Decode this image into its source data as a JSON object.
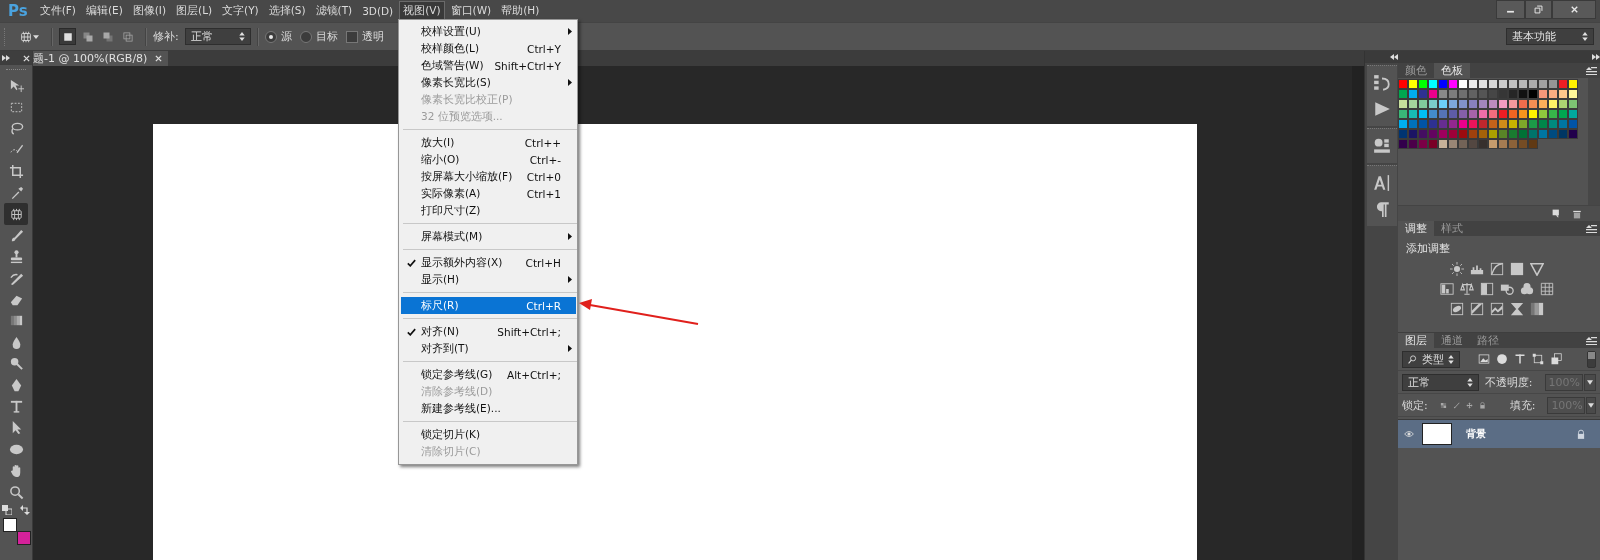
{
  "app_logo": "Ps",
  "menu_bar": [
    {
      "label": "文件(F)",
      "selected": false
    },
    {
      "label": "编辑(E)",
      "selected": false
    },
    {
      "label": "图像(I)",
      "selected": false
    },
    {
      "label": "图层(L)",
      "selected": false
    },
    {
      "label": "文字(Y)",
      "selected": false
    },
    {
      "label": "选择(S)",
      "selected": false
    },
    {
      "label": "滤镜(T)",
      "selected": false
    },
    {
      "label": "3D(D)",
      "selected": false
    },
    {
      "label": "视图(V)",
      "selected": true
    },
    {
      "label": "窗口(W)",
      "selected": false
    },
    {
      "label": "帮助(H)",
      "selected": false
    }
  ],
  "options_bar": {
    "mode_buttons": [
      {
        "selected": true
      },
      {
        "selected": false
      },
      {
        "selected": false
      },
      {
        "selected": false
      }
    ],
    "patch_label": "修补:",
    "patch_mode": "正常",
    "radios": [
      {
        "label": "源",
        "selected": true
      },
      {
        "label": "目标",
        "selected": false
      }
    ],
    "transparent": {
      "label": "透明",
      "checked": false
    },
    "workspace": "基本功能"
  },
  "document_tab": {
    "title": "题-1 @ 100%(RGB/8)"
  },
  "tools": [
    {
      "kind": "move",
      "selected": false
    },
    {
      "kind": "marquee",
      "selected": false
    },
    {
      "kind": "lasso",
      "selected": false
    },
    {
      "kind": "quick",
      "selected": false
    },
    {
      "kind": "crop",
      "selected": false
    },
    {
      "kind": "eyedropper",
      "selected": false
    },
    {
      "kind": "patch",
      "selected": true
    },
    {
      "kind": "brush",
      "selected": false
    },
    {
      "kind": "stamp",
      "selected": false
    },
    {
      "kind": "history",
      "selected": false
    },
    {
      "kind": "eraser",
      "selected": false
    },
    {
      "kind": "gradient",
      "selected": false
    },
    {
      "kind": "drop",
      "selected": false
    },
    {
      "kind": "dodge",
      "selected": false
    },
    {
      "kind": "pen",
      "selected": false
    },
    {
      "kind": "type",
      "selected": false
    },
    {
      "kind": "select",
      "selected": false
    },
    {
      "kind": "ellipse",
      "selected": false
    },
    {
      "kind": "hand",
      "selected": false
    },
    {
      "kind": "zoom",
      "selected": false
    }
  ],
  "colors": [
    {
      "kind": "foreground",
      "color": "#ffffff"
    },
    {
      "kind": "background",
      "color": "#d4219a"
    }
  ],
  "view_menu": {
    "groups": [
      {
        "items": [
          {
            "label": "校样设置(U)",
            "submenu": true,
            "disabled": false,
            "checked": false,
            "selected": false
          },
          {
            "label": "校样颜色(L)",
            "shortcut": "Ctrl+Y",
            "submenu": false,
            "disabled": false,
            "checked": false,
            "selected": false
          },
          {
            "label": "色域警告(W)",
            "shortcut": "Shift+Ctrl+Y",
            "submenu": false,
            "disabled": false,
            "checked": false,
            "selected": false
          },
          {
            "label": "像素长宽比(S)",
            "submenu": true,
            "disabled": false,
            "checked": false,
            "selected": false
          },
          {
            "label": "像素长宽比校正(P)",
            "submenu": false,
            "disabled": true,
            "checked": false,
            "selected": false
          },
          {
            "label": "32 位预览选项...",
            "submenu": false,
            "disabled": true,
            "checked": false,
            "selected": false
          }
        ]
      },
      {
        "items": [
          {
            "label": "放大(I)",
            "shortcut": "Ctrl++",
            "submenu": false,
            "disabled": false,
            "checked": false,
            "selected": false
          },
          {
            "label": "缩小(O)",
            "shortcut": "Ctrl+-",
            "submenu": false,
            "disabled": false,
            "checked": false,
            "selected": false
          },
          {
            "label": "按屏幕大小缩放(F)",
            "shortcut": "Ctrl+0",
            "submenu": false,
            "disabled": false,
            "checked": false,
            "selected": false
          },
          {
            "label": "实际像素(A)",
            "shortcut": "Ctrl+1",
            "submenu": false,
            "disabled": false,
            "checked": false,
            "selected": false
          },
          {
            "label": "打印尺寸(Z)",
            "submenu": false,
            "disabled": false,
            "checked": false,
            "selected": false
          }
        ]
      },
      {
        "items": [
          {
            "label": "屏幕模式(M)",
            "submenu": true,
            "disabled": false,
            "checked": false,
            "selected": false
          }
        ]
      },
      {
        "items": [
          {
            "label": "显示额外内容(X)",
            "shortcut": "Ctrl+H",
            "submenu": false,
            "disabled": false,
            "checked": true,
            "selected": false
          },
          {
            "label": "显示(H)",
            "submenu": true,
            "disabled": false,
            "checked": false,
            "selected": false
          }
        ]
      },
      {
        "items": [
          {
            "label": "标尺(R)",
            "shortcut": "Ctrl+R",
            "submenu": false,
            "disabled": false,
            "checked": false,
            "selected": true
          }
        ]
      },
      {
        "items": [
          {
            "label": "对齐(N)",
            "shortcut": "Shift+Ctrl+;",
            "submenu": false,
            "disabled": false,
            "checked": true,
            "selected": false
          },
          {
            "label": "对齐到(T)",
            "submenu": true,
            "disabled": false,
            "checked": false,
            "selected": false
          }
        ]
      },
      {
        "items": [
          {
            "label": "锁定参考线(G)",
            "shortcut": "Alt+Ctrl+;",
            "submenu": false,
            "disabled": false,
            "checked": false,
            "selected": false
          },
          {
            "label": "清除参考线(D)",
            "submenu": false,
            "disabled": true,
            "checked": false,
            "selected": false
          },
          {
            "label": "新建参考线(E)...",
            "submenu": false,
            "disabled": false,
            "checked": false,
            "selected": false
          }
        ]
      },
      {
        "items": [
          {
            "label": "锁定切片(K)",
            "submenu": false,
            "disabled": false,
            "checked": false,
            "selected": false
          },
          {
            "label": "清除切片(C)",
            "submenu": false,
            "disabled": true,
            "checked": false,
            "selected": false
          }
        ]
      }
    ]
  },
  "swatches_panel": {
    "tabs": [
      {
        "label": "颜色",
        "selected": false
      },
      {
        "label": "色板",
        "selected": true
      }
    ],
    "rows": [
      {
        "swatches": [
          {
            "color": "#ff0000"
          },
          {
            "color": "#ffff00"
          },
          {
            "color": "#00ff00"
          },
          {
            "color": "#00ffff"
          },
          {
            "color": "#0000ff"
          },
          {
            "color": "#ff00ff"
          },
          {
            "color": "#ffffff"
          },
          {
            "color": "#ebebeb"
          },
          {
            "color": "#e1e1e1"
          },
          {
            "color": "#d7d7d7"
          },
          {
            "color": "#cccccc"
          },
          {
            "color": "#c2c2c2"
          },
          {
            "color": "#b7b7b7"
          },
          {
            "color": "#acacac"
          },
          {
            "color": "#a0a0a0"
          },
          {
            "color": "#959595"
          },
          {
            "color": "#ee1d24"
          },
          {
            "color": "#fff100"
          }
        ]
      },
      {
        "swatches": [
          {
            "color": "#00a650"
          },
          {
            "color": "#00aeef"
          },
          {
            "color": "#2e3192"
          },
          {
            "color": "#ec008c"
          },
          {
            "color": "#898989"
          },
          {
            "color": "#7d7d7d"
          },
          {
            "color": "#707070"
          },
          {
            "color": "#626262"
          },
          {
            "color": "#555555"
          },
          {
            "color": "#464646"
          },
          {
            "color": "#363636"
          },
          {
            "color": "#262626"
          },
          {
            "color": "#111111"
          },
          {
            "color": "#000000"
          },
          {
            "color": "#f7977a"
          },
          {
            "color": "#fbad82"
          },
          {
            "color": "#fdc68c"
          },
          {
            "color": "#fff799"
          }
        ]
      },
      {
        "swatches": [
          {
            "color": "#c6df9c"
          },
          {
            "color": "#a4d49d"
          },
          {
            "color": "#81ca9d"
          },
          {
            "color": "#7bcdc9"
          },
          {
            "color": "#6ccff6"
          },
          {
            "color": "#7da7d9"
          },
          {
            "color": "#8293ca"
          },
          {
            "color": "#8881be"
          },
          {
            "color": "#a286bd"
          },
          {
            "color": "#bc8cbf"
          },
          {
            "color": "#f49bc1"
          },
          {
            "color": "#f5999d"
          },
          {
            "color": "#f16c4d"
          },
          {
            "color": "#f68e54"
          },
          {
            "color": "#fbaf5a"
          },
          {
            "color": "#fff467"
          },
          {
            "color": "#acd372"
          },
          {
            "color": "#7dc473"
          }
        ]
      },
      {
        "swatches": [
          {
            "color": "#39b778"
          },
          {
            "color": "#17bcb4"
          },
          {
            "color": "#00bff3"
          },
          {
            "color": "#438ccb"
          },
          {
            "color": "#5573b7"
          },
          {
            "color": "#5e5ca7"
          },
          {
            "color": "#855fa8"
          },
          {
            "color": "#a763a9"
          },
          {
            "color": "#ef6ea8"
          },
          {
            "color": "#f16d7e"
          },
          {
            "color": "#ee1d24"
          },
          {
            "color": "#f16522"
          },
          {
            "color": "#f7941d"
          },
          {
            "color": "#fff100"
          },
          {
            "color": "#8fc63d"
          },
          {
            "color": "#37b44a"
          },
          {
            "color": "#00a650"
          },
          {
            "color": "#00a99e"
          }
        ]
      },
      {
        "swatches": [
          {
            "color": "#00aeef"
          },
          {
            "color": "#0072bc"
          },
          {
            "color": "#0054a6"
          },
          {
            "color": "#2e3192"
          },
          {
            "color": "#662d91"
          },
          {
            "color": "#92278f"
          },
          {
            "color": "#ec008c"
          },
          {
            "color": "#ed145b"
          },
          {
            "color": "#c1272d"
          },
          {
            "color": "#c4621a"
          },
          {
            "color": "#d08b1a"
          },
          {
            "color": "#c8b400"
          },
          {
            "color": "#7ea82a"
          },
          {
            "color": "#1c9a48"
          },
          {
            "color": "#00874a"
          },
          {
            "color": "#008a7e"
          },
          {
            "color": "#0076a3"
          },
          {
            "color": "#0054a6"
          }
        ]
      },
      {
        "swatches": [
          {
            "color": "#003471"
          },
          {
            "color": "#1b1464"
          },
          {
            "color": "#440e62"
          },
          {
            "color": "#630460"
          },
          {
            "color": "#9e005d"
          },
          {
            "color": "#9e0039"
          },
          {
            "color": "#9e0b0f"
          },
          {
            "color": "#a0410d"
          },
          {
            "color": "#a36209"
          },
          {
            "color": "#aba000"
          },
          {
            "color": "#598527"
          },
          {
            "color": "#1a7b30"
          },
          {
            "color": "#007236"
          },
          {
            "color": "#00746b"
          },
          {
            "color": "#0076a3"
          },
          {
            "color": "#004b80"
          },
          {
            "color": "#003663"
          },
          {
            "color": "#21004b"
          }
        ]
      },
      {
        "swatches": [
          {
            "color": "#32004b"
          },
          {
            "color": "#4b0049"
          },
          {
            "color": "#7b0046"
          },
          {
            "color": "#7a0026"
          },
          {
            "color": "#c7b299"
          },
          {
            "color": "#998675"
          },
          {
            "color": "#736357"
          },
          {
            "color": "#534741"
          },
          {
            "color": "#37302d"
          },
          {
            "color": "#c69c6d"
          },
          {
            "color": "#a67c52"
          },
          {
            "color": "#8c6239"
          },
          {
            "color": "#754c24"
          },
          {
            "color": "#603913"
          }
        ]
      }
    ]
  },
  "adjustments_panel": {
    "tabs": [
      {
        "label": "调整",
        "selected": true
      },
      {
        "label": "样式",
        "selected": false
      }
    ],
    "heading": "添加调整",
    "icon_rows": [
      [
        {
          "kind": "sun"
        },
        {
          "kind": "histogram"
        },
        {
          "kind": "curve"
        },
        {
          "kind": "exposure"
        },
        {
          "kind": "triangle"
        }
      ],
      [
        {
          "kind": "hue"
        },
        {
          "kind": "scale"
        },
        {
          "kind": "half"
        },
        {
          "kind": "camera"
        },
        {
          "kind": "circles"
        },
        {
          "kind": "grid"
        }
      ],
      [
        {
          "kind": "invert"
        },
        {
          "kind": "stripes"
        },
        {
          "kind": "zigzag"
        },
        {
          "kind": "hourglass"
        },
        {
          "kind": "fade"
        }
      ]
    ]
  },
  "layers_panel": {
    "tabs": [
      {
        "label": "图层",
        "selected": true
      },
      {
        "label": "通道",
        "selected": false
      },
      {
        "label": "路径",
        "selected": false
      }
    ],
    "filter": "类型",
    "filter_enabled": false,
    "blend_mode": "正常",
    "opacity_label": "不透明度:",
    "opacity": {
      "value": "100%",
      "disabled": true
    },
    "lock_label": "锁定:",
    "fill_label": "填充:",
    "fill": {
      "value": "100%",
      "disabled": true
    },
    "layers": [
      {
        "name": "背景",
        "selected": true,
        "visible": true,
        "locked": true
      }
    ]
  }
}
